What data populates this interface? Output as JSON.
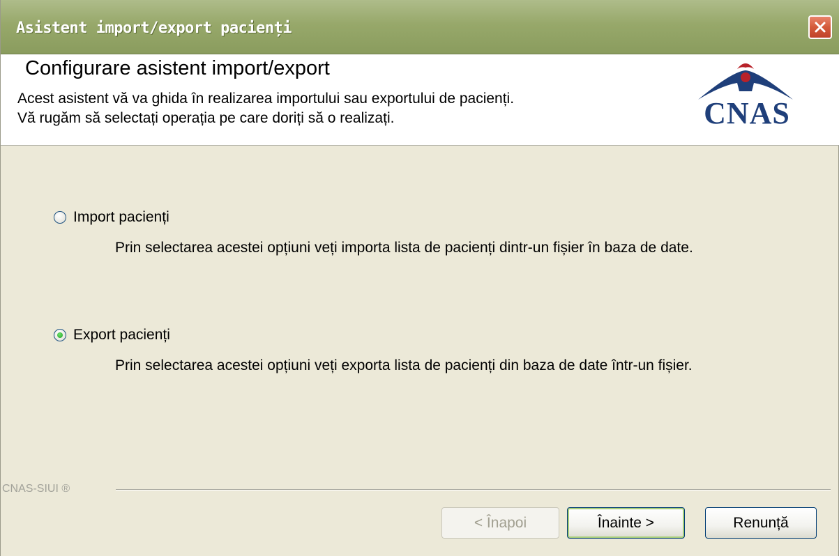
{
  "window": {
    "title": "Asistent import/export pacienți"
  },
  "header": {
    "title": "Configurare asistent import/export",
    "description_line1": "Acest asistent vă va ghida în realizarea importului sau exportului de pacienți.",
    "description_line2": "Vă rugăm să selectați operația pe care doriți să o realizați.",
    "logo_text": "CNAS"
  },
  "options": [
    {
      "label": "Import pacienți",
      "checked": false,
      "description": "Prin selectarea acestei opțiuni veți importa lista de pacienți dintr-un fișier în baza de date."
    },
    {
      "label": "Export pacienți",
      "checked": true,
      "description": "Prin selectarea acestei opțiuni veți exporta lista de pacienți din baza de date într-un fișier."
    }
  ],
  "footer": {
    "brand": "CNAS-SIUI ®"
  },
  "buttons": {
    "back": "< Înapoi",
    "next": "Înainte >",
    "cancel": "Renunță"
  },
  "colors": {
    "titlebar": "#97a86a",
    "close": "#d45a3a",
    "logo_blue": "#1f3f7a",
    "logo_red": "#b8222a",
    "background": "#ece9d8"
  },
  "icons": {
    "close": "close-icon",
    "logo": "cnas-logo"
  }
}
